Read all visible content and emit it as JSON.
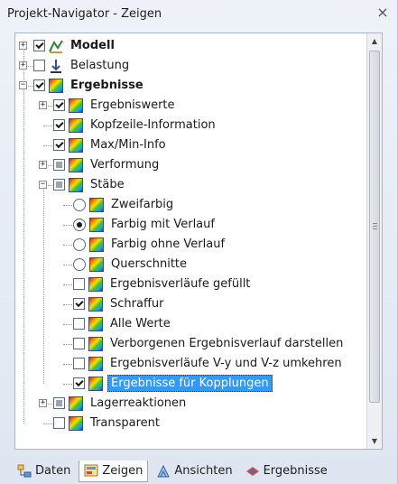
{
  "window": {
    "title": "Projekt-Navigator - Zeigen",
    "close_glyph": "×"
  },
  "tree": {
    "items": [
      {
        "label": "Modell",
        "check": "checked",
        "icon": "model-icon",
        "bold": true,
        "expander": "plus"
      },
      {
        "label": "Belastung",
        "check": "unchecked",
        "icon": "load-icon",
        "bold": false,
        "expander": "plus"
      },
      {
        "label": "Ergebnisse",
        "check": "checked",
        "icon": "results-icon",
        "bold": true,
        "expander": "minus"
      },
      {
        "label": "Ergebniswerte",
        "check": "checked",
        "icon": "results-icon",
        "expander": "plus"
      },
      {
        "label": "Kopfzeile-Information",
        "check": "checked",
        "icon": "results-icon"
      },
      {
        "label": "Max/Min-Info",
        "check": "checked",
        "icon": "results-icon"
      },
      {
        "label": "Verformung",
        "check": "partial",
        "icon": "results-icon",
        "expander": "plus"
      },
      {
        "label": "Stäbe",
        "check": "partial",
        "icon": "results-icon",
        "expander": "minus"
      },
      {
        "label": "Zweifarbig",
        "radio": "unselected",
        "icon": "results-icon"
      },
      {
        "label": "Farbig mit Verlauf",
        "radio": "selected",
        "icon": "results-icon"
      },
      {
        "label": "Farbig ohne Verlauf",
        "radio": "unselected",
        "icon": "results-icon"
      },
      {
        "label": "Querschnitte",
        "radio": "unselected",
        "icon": "results-icon"
      },
      {
        "label": "Ergebnisverläufe gefüllt",
        "check": "unchecked",
        "icon": "results-icon"
      },
      {
        "label": "Schraffur",
        "check": "checked",
        "icon": "results-icon"
      },
      {
        "label": "Alle Werte",
        "check": "unchecked",
        "icon": "results-icon"
      },
      {
        "label": "Verborgenen Ergebnisverlauf darstellen",
        "check": "unchecked",
        "icon": "results-icon"
      },
      {
        "label": "Ergebnisverläufe V-y und V-z umkehren",
        "check": "unchecked",
        "icon": "results-icon"
      },
      {
        "label": "Ergebnisse für Kopplungen",
        "check": "checked",
        "icon": "results-icon",
        "selected": true
      },
      {
        "label": "Lagerreaktionen",
        "check": "partial",
        "icon": "results-icon",
        "expander": "plus"
      },
      {
        "label": "Transparent",
        "check": "unchecked",
        "icon": "results-icon"
      }
    ]
  },
  "tabs": [
    {
      "label": "Daten",
      "icon": "data-tree-icon",
      "active": false
    },
    {
      "label": "Zeigen",
      "icon": "display-icon",
      "active": true
    },
    {
      "label": "Ansichten",
      "icon": "views-icon",
      "active": false
    },
    {
      "label": "Ergebnisse",
      "icon": "results-tab-icon",
      "active": false
    }
  ]
}
